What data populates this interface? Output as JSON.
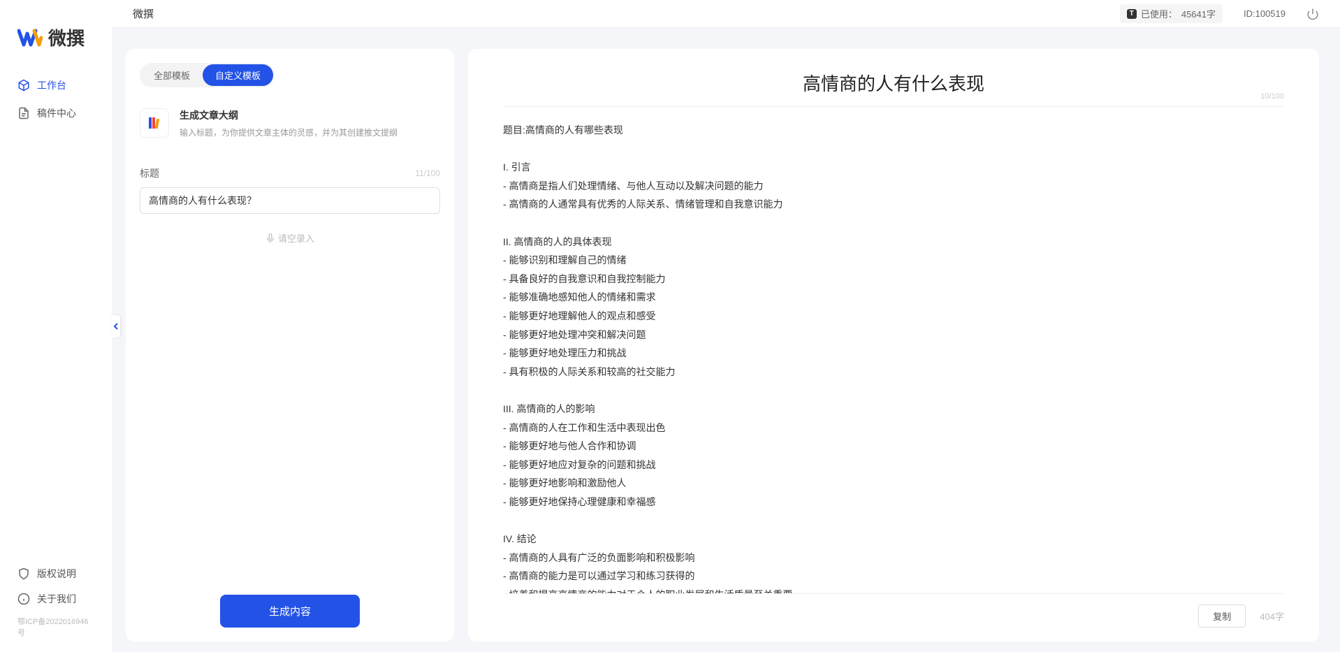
{
  "app": {
    "name": "微撰",
    "logo_text": "微撰"
  },
  "sidebar": {
    "nav": [
      {
        "label": "工作台",
        "active": true
      },
      {
        "label": "稿件中心",
        "active": false
      }
    ],
    "footer": [
      {
        "label": "版权说明"
      },
      {
        "label": "关于我们"
      }
    ],
    "icp": "鄂ICP备2022016946号"
  },
  "topbar": {
    "title": "微撰",
    "usage_prefix": "已使用：",
    "usage_value": "45641字",
    "user_id": "ID:100519"
  },
  "left_panel": {
    "tabs": [
      {
        "label": "全部模板",
        "active": false
      },
      {
        "label": "自定义模板",
        "active": true
      }
    ],
    "template": {
      "title": "生成文章大纲",
      "desc": "输入标题，为你提供文章主体的灵感，并为其创建推文提纲"
    },
    "title_field": {
      "label": "标题",
      "counter": "11/100",
      "value": "高情商的人有什么表现？"
    },
    "voice_input_label": "请空录入",
    "generate_label": "生成内容"
  },
  "right_panel": {
    "title": "高情商的人有什么表现",
    "header_counter": "10/100",
    "content": "题目:高情商的人有哪些表现\n\nI. 引言\n- 高情商是指人们处理情绪、与他人互动以及解决问题的能力\n- 高情商的人通常具有优秀的人际关系、情绪管理和自我意识能力\n\nII. 高情商的人的具体表现\n- 能够识别和理解自己的情绪\n- 具备良好的自我意识和自我控制能力\n- 能够准确地感知他人的情绪和需求\n- 能够更好地理解他人的观点和感受\n- 能够更好地处理冲突和解决问题\n- 能够更好地处理压力和挑战\n- 具有积极的人际关系和较高的社交能力\n\nIII. 高情商的人的影响\n- 高情商的人在工作和生活中表现出色\n- 能够更好地与他人合作和协调\n- 能够更好地应对复杂的问题和挑战\n- 能够更好地影响和激励他人\n- 能够更好地保持心理健康和幸福感\n\nIV. 结论\n- 高情商的人具有广泛的负面影响和积极影响\n- 高情商的能力是可以通过学习和练习获得的\n- 培养和提高高情商的能力对于个人的职业发展和生活质量至关重要。",
    "copy_label": "复制",
    "word_count": "404字"
  }
}
